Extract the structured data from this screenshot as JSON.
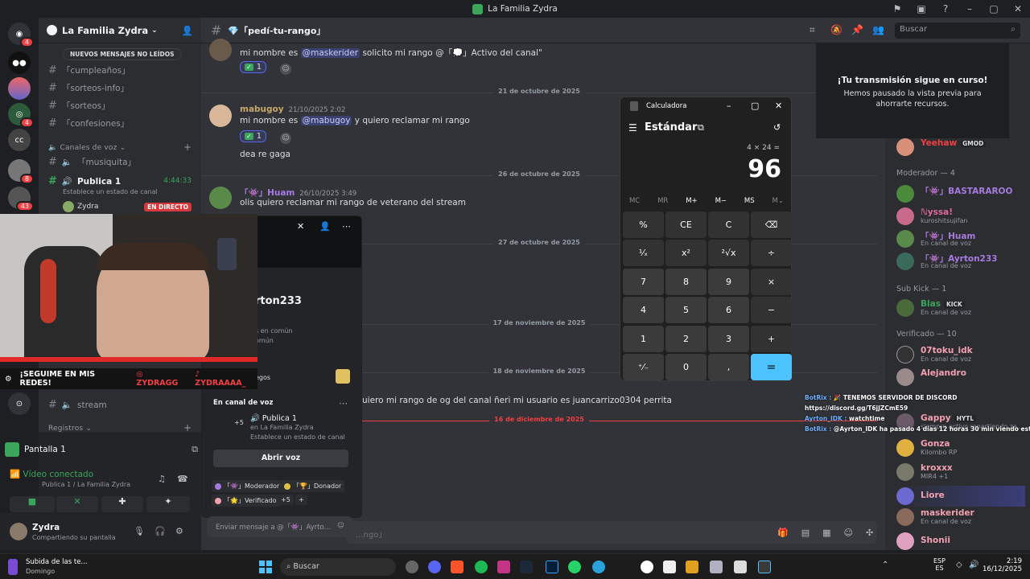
{
  "window": {
    "title": "La Familia Zydra"
  },
  "server": {
    "name": "La Familia Zydra",
    "new_messages": "NUEVOS MENSAJES NO LEÍDOS"
  },
  "channels": {
    "text": [
      "「cumpleaños」",
      "「sorteos-info」",
      "「sorteos」",
      "「confesiones」"
    ],
    "voice_category": "Canales de voz",
    "voice": [
      {
        "name": "「musiquita」"
      },
      {
        "name": "Publica 1",
        "time": "4:44:33",
        "status": "Establece un estado de canal",
        "member": "Zydra",
        "live": "EN DIRECTO"
      }
    ],
    "stream_channel": "stream",
    "registros": "Registros"
  },
  "voice_panel": {
    "title": "Pantalla 1",
    "connected": "Vídeo conectado",
    "location": "Publica 1 / La Familia Zydra"
  },
  "user_panel": {
    "name": "Zydra",
    "status": "Compartiendo su pantalla"
  },
  "chat": {
    "channel": "💎「pedí-tu-rango」",
    "search_placeholder": "Buscar",
    "composer_placeholder": "...ngo」",
    "messages": [
      {
        "text_pre": "mi nombre es",
        "mention": "@maskerider",
        "text_post": "solicito mi rango @「💭」Activo del canal\"",
        "reaction": "1"
      },
      {
        "author": "mabugoy",
        "time": "21/10/2025 2:02",
        "text_pre": "mi nombre es",
        "mention": "@mabugoy",
        "text_post": "y quiero reclamar mi rango",
        "reaction": "1",
        "extra": "dea re gaga"
      },
      {
        "author": "「👾」Huam",
        "time": "26/10/2025 3:49",
        "text": "olis quiero reclamar mi rango de veterano del stream"
      },
      {
        "text": "uiero mi rango de og del canal ñeri mi usuario es juancarrizo0304 perrita"
      }
    ],
    "dividers": [
      "21 de octubre de 2025",
      "26 de octubre de 2025",
      "27 de octubre de 2025",
      "17 de noviembre de 2025",
      "18 de noviembre de 2025",
      "16 de diciembre de 2025"
    ]
  },
  "stream_notice": {
    "title": "¡Tu transmisión sigue en curso!",
    "subtitle": "Hemos pausado la vista previa para ahorrarte recursos."
  },
  "calculator": {
    "title": "Calculadora",
    "mode": "Estándar",
    "expression": "4 × 24 =",
    "result": "96",
    "memory": [
      "MC",
      "MR",
      "M+",
      "M−",
      "MS",
      "M⌄"
    ],
    "keys": [
      "%",
      "CE",
      "C",
      "⌫",
      "¹⁄ₓ",
      "x²",
      "²√x",
      "÷",
      "7",
      "8",
      "9",
      "×",
      "4",
      "5",
      "6",
      "−",
      "1",
      "2",
      "3",
      "+",
      "⁺⁄₋",
      "0",
      ",",
      "="
    ]
  },
  "profile": {
    "name": "rton233",
    "mutual": "s en común",
    "mutual2": "omún",
    "games": "egos",
    "voice_title": "En canal de voz",
    "voice_channel": "Publica 1",
    "voice_server": "en La Familia Zydra",
    "voice_status": "Establece un estado de canal",
    "voice_count": "+5",
    "open_voice": "Abrir voz",
    "roles": [
      "「👾」Moderador",
      "「🏆」Donador",
      "「🌟」Verificado"
    ],
    "roles_more": "+5",
    "message_placeholder": "Enviar mensaje a @「👾」Ayrto..."
  },
  "socials": {
    "text": "¡SEGUIME EN MIS REDES!",
    "ig": "ZYDRAGG",
    "tiktok": "ZYDRAAAA_"
  },
  "overlay_chat": [
    {
      "user": "BotRix :",
      "text": "🎉 TENEMOS SERVIDOR DE DISCORD"
    },
    {
      "user": "",
      "text": "https://discord.gg/T6jJZCmE59"
    },
    {
      "user": "Ayrton_IDK :",
      "text": "watchtime"
    },
    {
      "user": "BotRix :",
      "text": "@Ayrton_IDK ha pasado 4 días 12 horas 30 min viendo este canal"
    }
  ],
  "members": {
    "top": {
      "name": "Yeehaw",
      "tag": "GMOD"
    },
    "categories": [
      "Moderador — 4",
      "Sub Kick — 1",
      "Verificado — 10"
    ],
    "moderators": [
      {
        "name": "「👾」BASTARAROO",
        "status": ""
      },
      {
        "name": "ℕyssa!",
        "status": "kuroshitsujifan"
      },
      {
        "name": "「👾」Huam",
        "status": "En canal de voz"
      },
      {
        "name": "「👾」Ayrton233",
        "status": "En canal de voz"
      }
    ],
    "sub": [
      {
        "name": "Blas",
        "tag": "KICK",
        "status": "En canal de voz"
      }
    ],
    "verified": [
      {
        "name": "07toku_idk",
        "status": "En canal de voz"
      },
      {
        "name": "Alejandro",
        "status": ""
      },
      {
        "name": "Gappy",
        "tag": "HYTL",
        "status": "siempre activo repartiendo za..."
      },
      {
        "name": "Gonza",
        "status": "Kilombo RP"
      },
      {
        "name": "kroxxx",
        "status": "MIR4 +1"
      },
      {
        "name": "Liore",
        "status": ""
      },
      {
        "name": "maskerider",
        "status": "En canal de voz"
      },
      {
        "name": "Shonii",
        "status": ""
      }
    ]
  },
  "taskbar": {
    "media_title": "Subida de las te...",
    "media_sub": "Domingo",
    "search": "Buscar",
    "lang": "ESP",
    "lang2": "ES",
    "time": "2:19",
    "date": "16/12/2025"
  },
  "colors": {
    "accent": "#5865f2",
    "live": "#da373c",
    "calc_equals": "#4cc2ff",
    "mention_bg": "#3c4270"
  }
}
